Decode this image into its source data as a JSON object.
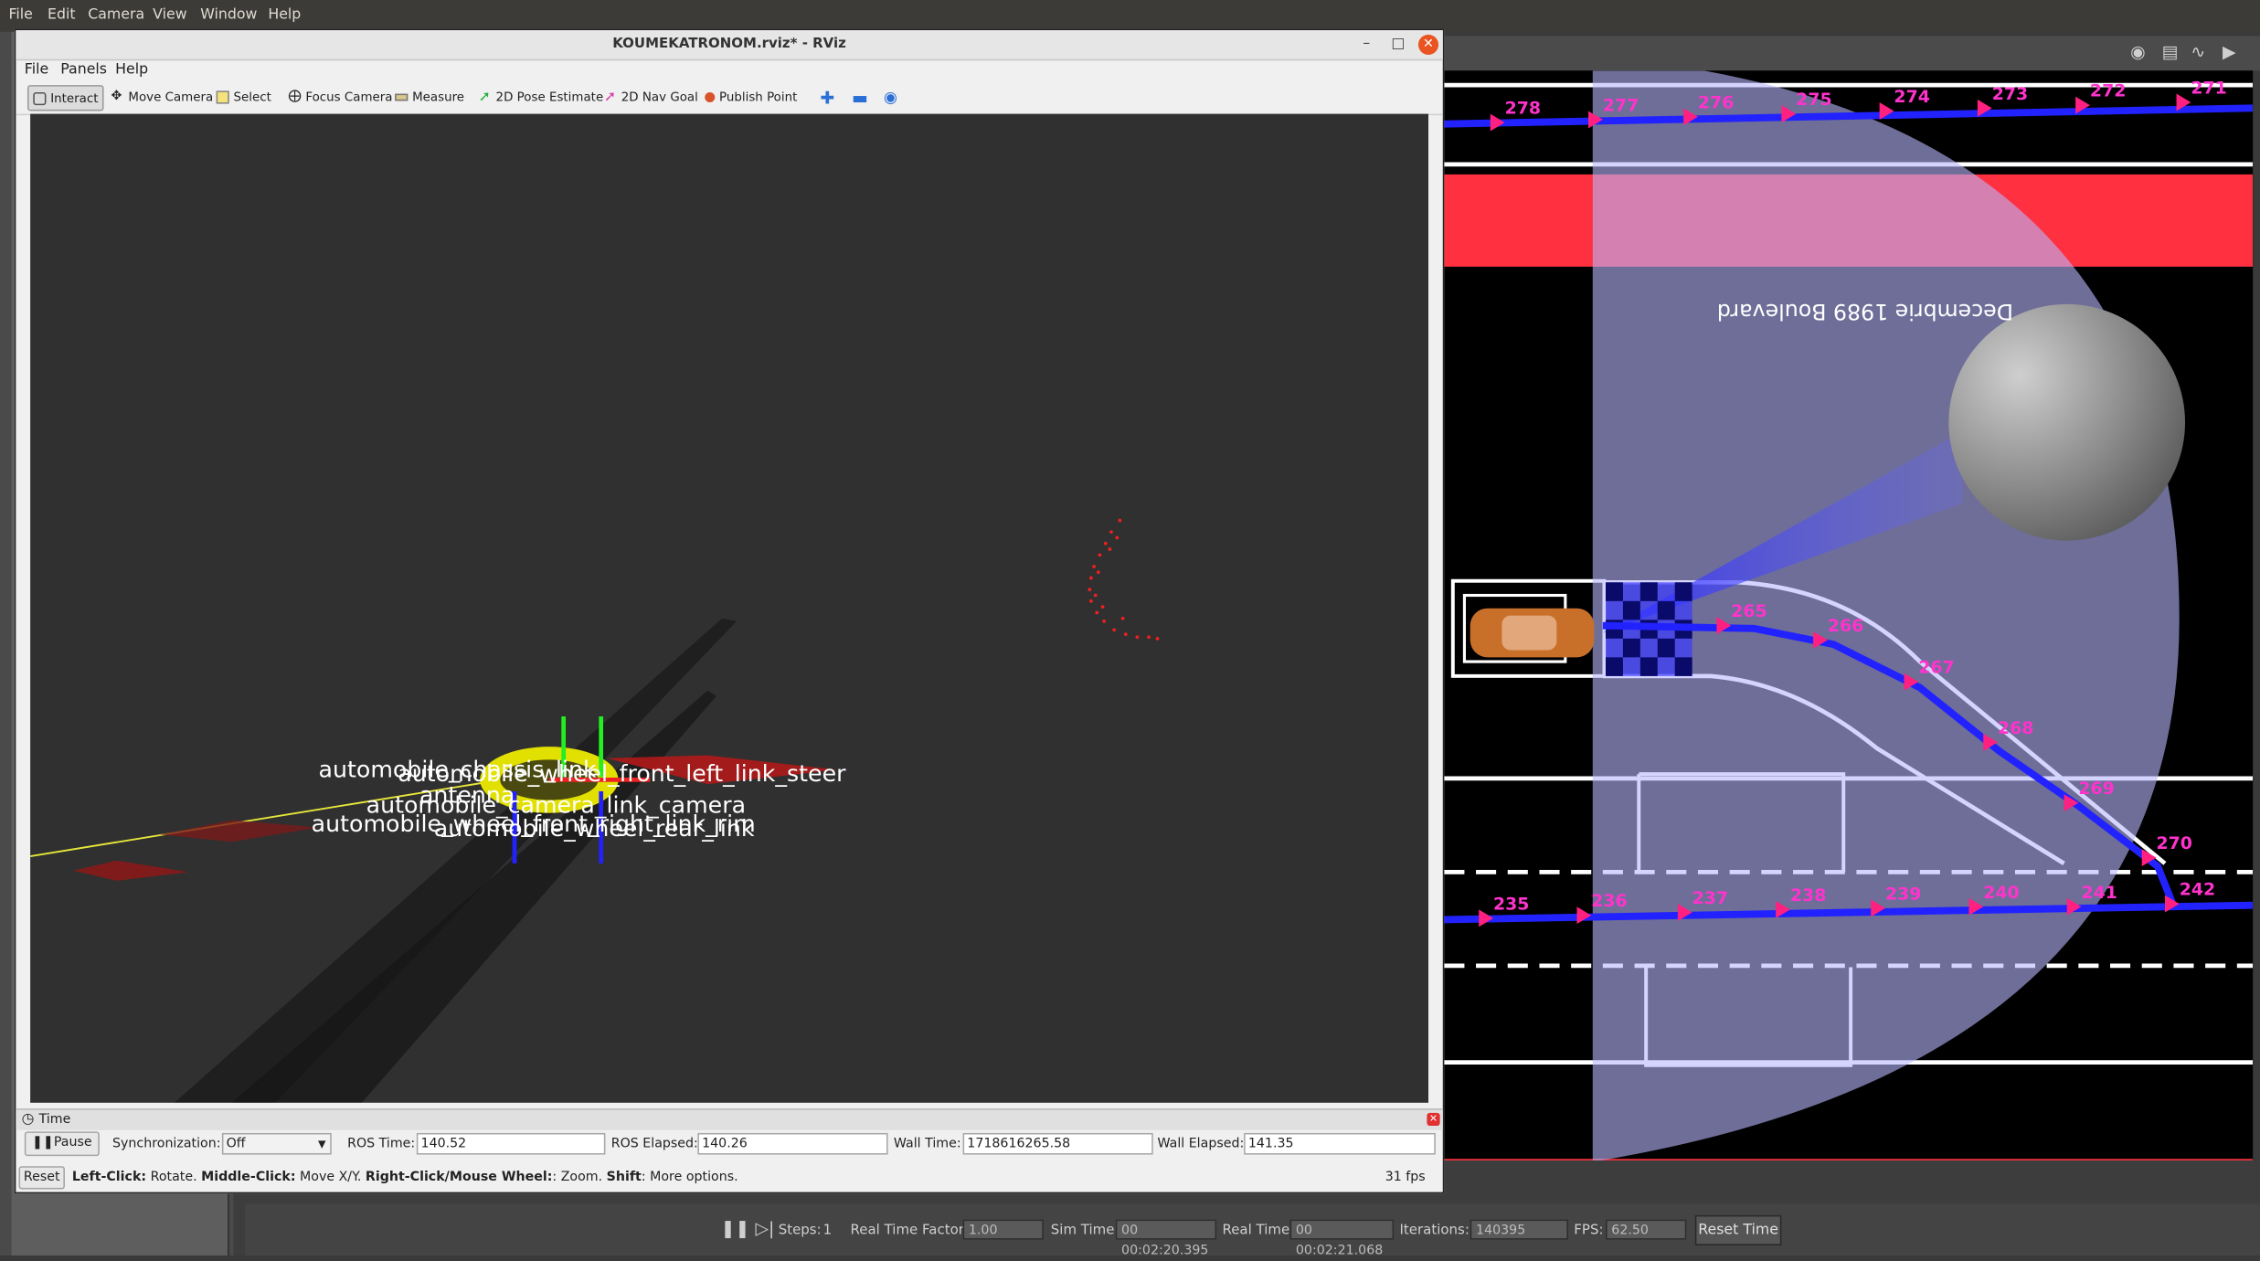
{
  "gazebo": {
    "menubar": [
      "File",
      "Edit",
      "Camera",
      "View",
      "Window",
      "Help"
    ],
    "status": {
      "steps_label": "Steps:",
      "steps_value": "1",
      "rtf_label": "Real Time Factor:",
      "rtf_value": "1.00",
      "sim_time_label": "Sim Time:",
      "sim_time_value": "00 00:02:20.395",
      "real_time_label": "Real Time:",
      "real_time_value": "00 00:02:21.068",
      "iterations_label": "Iterations:",
      "iterations_value": "140395",
      "fps_label": "FPS:",
      "fps_value": "62.50",
      "reset_label": "Reset Time"
    },
    "scene": {
      "street_name": "Decembrie 1989 Boulevard",
      "top_lane_nodes": [
        "278",
        "277",
        "276",
        "275",
        "274",
        "273",
        "272",
        "271"
      ],
      "curve_nodes": [
        "265",
        "266",
        "267",
        "268",
        "269",
        "270"
      ],
      "bottom_lane_nodes": [
        "235",
        "236",
        "237",
        "238",
        "239",
        "240",
        "241",
        "242"
      ]
    }
  },
  "rviz": {
    "title": "KOUMEKATRONOM.rviz* - RViz",
    "menu": [
      "File",
      "Panels",
      "Help"
    ],
    "tools": {
      "interact": "Interact",
      "move_camera": "Move Camera",
      "select": "Select",
      "focus_camera": "Focus Camera",
      "measure": "Measure",
      "pose_estimate": "2D Pose Estimate",
      "nav_goal": "2D Nav Goal",
      "publish_point": "Publish Point"
    },
    "tf_labels": [
      "automobile_chassis_link",
      "automobile_camera_link_camera",
      "automobile_wheel_front_right_link_rim",
      "automobile_wheel_front_left_link_steer",
      "automobile_wheel_rear_link",
      "antenna"
    ],
    "time_panel": {
      "title": "Time",
      "pause_label": "Pause",
      "sync_label": "Synchronization:",
      "sync_value": "Off",
      "ros_time_label": "ROS Time:",
      "ros_time_value": "140.52",
      "ros_elapsed_label": "ROS Elapsed:",
      "ros_elapsed_value": "140.26",
      "wall_time_label": "Wall Time:",
      "wall_time_value": "1718616265.58",
      "wall_elapsed_label": "Wall Elapsed:",
      "wall_elapsed_value": "141.35"
    },
    "help": {
      "reset_label": "Reset",
      "left_click_key": "Left-Click:",
      "left_click_text": " Rotate. ",
      "middle_click_key": "Middle-Click:",
      "middle_click_text": " Move X/Y. ",
      "right_click_key": "Right-Click/Mouse Wheel:",
      "right_click_text": ": Zoom. ",
      "shift_key": "Shift",
      "shift_text": ": More options.",
      "fps": "31 fps"
    }
  }
}
